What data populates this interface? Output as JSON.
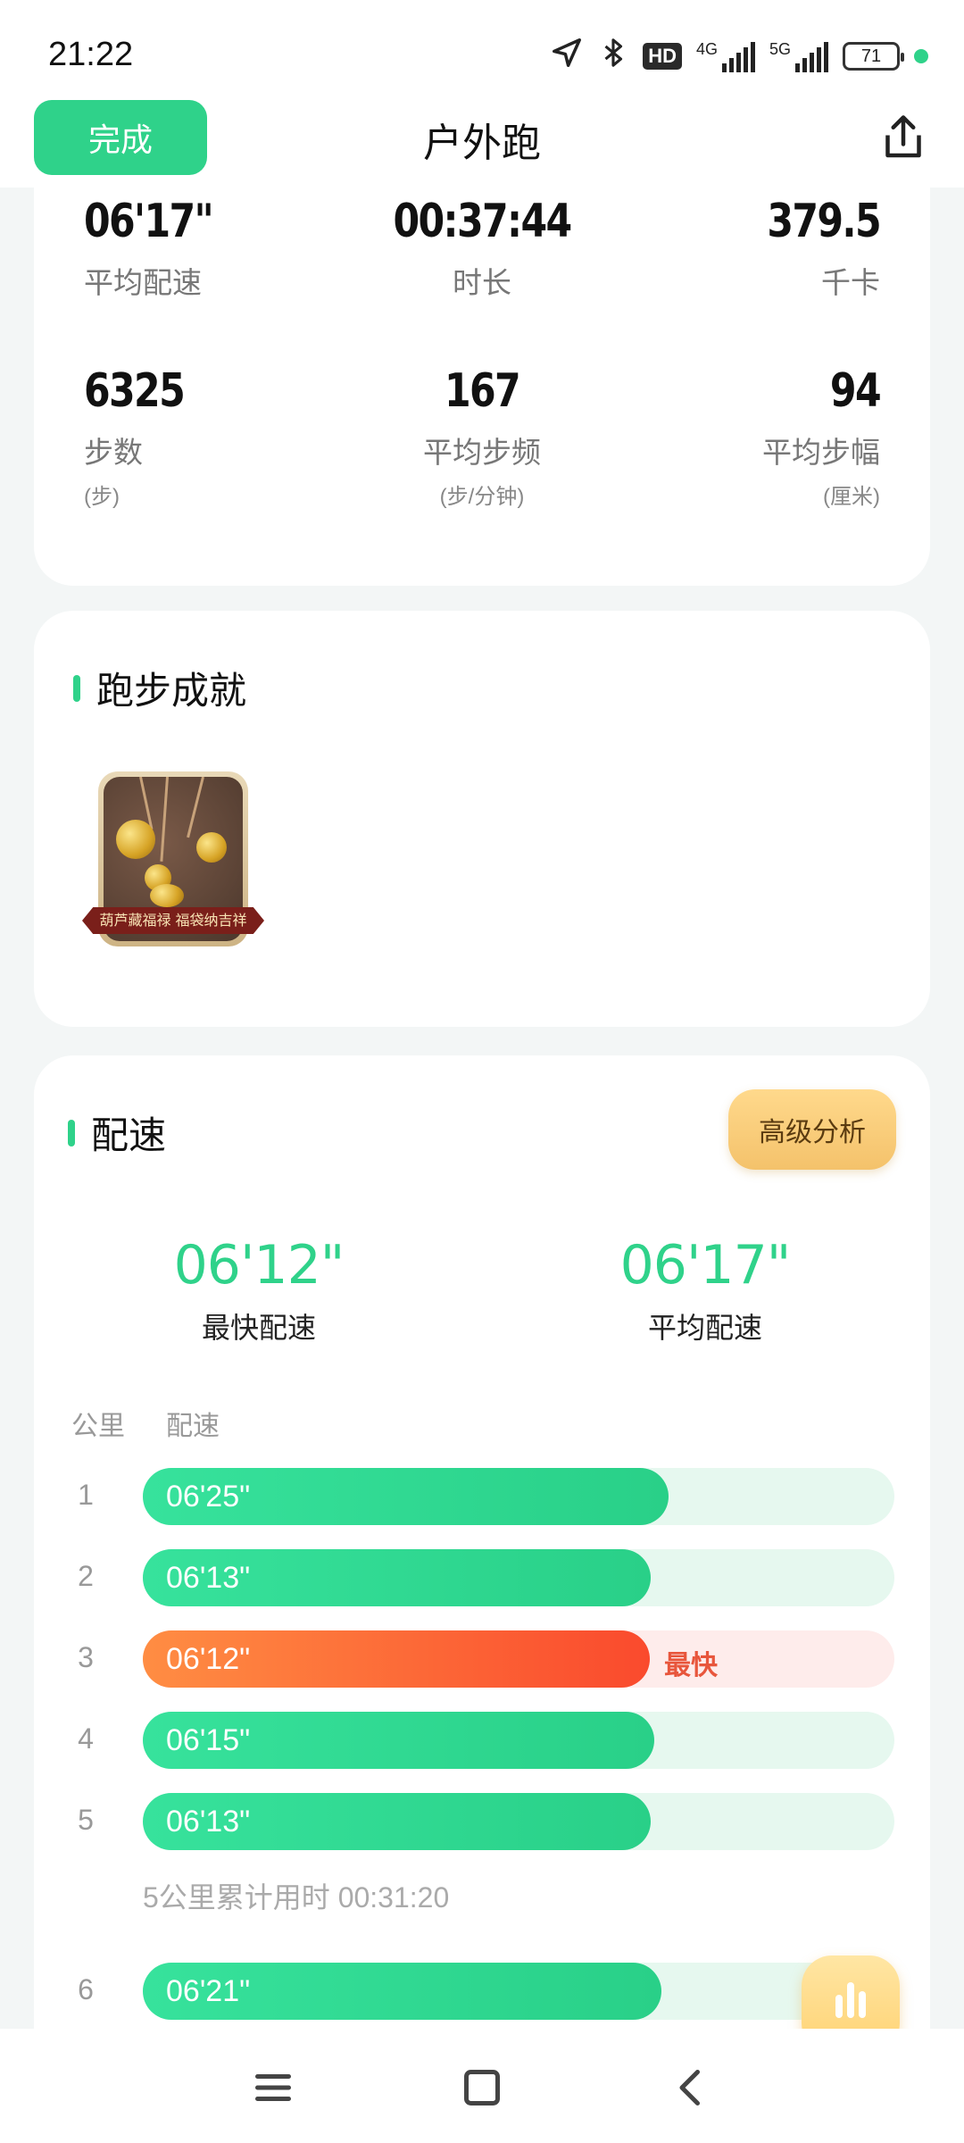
{
  "status": {
    "time": "21:22",
    "hd": "HD",
    "net1": "4G",
    "net2": "5G",
    "battery": "71"
  },
  "header": {
    "done_label": "完成",
    "title": "户外跑"
  },
  "stats": [
    {
      "value": "06'17\"",
      "label": "平均配速",
      "unit": ""
    },
    {
      "value": "00:37:44",
      "label": "时长",
      "unit": ""
    },
    {
      "value": "379.5",
      "label": "千卡",
      "unit": ""
    },
    {
      "value": "6325",
      "label": "步数",
      "unit": "(步)"
    },
    {
      "value": "167",
      "label": "平均步频",
      "unit": "(步/分钟)"
    },
    {
      "value": "94",
      "label": "平均步幅",
      "unit": "(厘米)"
    }
  ],
  "achievements": {
    "title": "跑步成就",
    "badge_caption": "葫芦藏福禄 福袋纳吉祥"
  },
  "pace": {
    "title": "配速",
    "advanced_label": "高级分析",
    "fastest_value": "06'12\"",
    "fastest_label": "最快配速",
    "average_value": "06'17\"",
    "average_label": "平均配速",
    "col_km": "公里",
    "col_pace": "配速",
    "fastest_tag": "最快",
    "splits": [
      {
        "km": "1",
        "pace": "06'25\"",
        "fill": 0.7
      },
      {
        "km": "2",
        "pace": "06'13\"",
        "fill": 0.676
      },
      {
        "km": "3",
        "pace": "06'12\"",
        "fill": 0.674
      },
      {
        "km": "4",
        "pace": "06'15\"",
        "fill": 0.68
      },
      {
        "km": "5",
        "pace": "06'13\"",
        "fill": 0.676
      },
      {
        "km": "6",
        "pace": "06'21\"",
        "fill": 0.69
      }
    ],
    "cumulative": "5公里累计用时 00:31:20"
  }
}
